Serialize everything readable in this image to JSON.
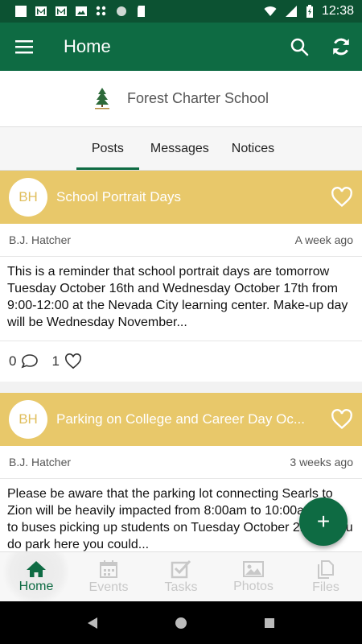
{
  "status_bar": {
    "time": "12:38"
  },
  "app_bar": {
    "title": "Home"
  },
  "school": {
    "name": "Forest Charter School"
  },
  "tabs": [
    {
      "label": "Posts",
      "active": true
    },
    {
      "label": "Messages",
      "active": false
    },
    {
      "label": "Notices",
      "active": false
    }
  ],
  "posts": [
    {
      "initials": "BH",
      "title": "School Portrait Days",
      "author": "B.J. Hatcher",
      "time": "A week ago",
      "body": "This is a reminder that school portrait days are tomorrow Tuesday October 16th and Wednesday October 17th from 9:00-12:00 at the Nevada City learning center. Make-up day will be Wednesday November...",
      "comments": "0",
      "likes": "1"
    },
    {
      "initials": "BH",
      "title": "Parking on College and Career Day Oc...",
      "author": "B.J. Hatcher",
      "time": "3 weeks ago",
      "body": "Please be aware that the parking lot connecting Searls to Zion will be heavily impacted from 8:00am to 10:00am due to buses picking up students on Tuesday October 2nd. If you do park here you could..."
    }
  ],
  "fab": {
    "label": "+"
  },
  "bottom_nav": [
    {
      "label": "Home",
      "icon": "home-icon",
      "active": true
    },
    {
      "label": "Events",
      "icon": "calendar-icon",
      "active": false
    },
    {
      "label": "Tasks",
      "icon": "tasks-icon",
      "active": false
    },
    {
      "label": "Photos",
      "icon": "photo-icon",
      "active": false
    },
    {
      "label": "Files",
      "icon": "files-icon",
      "active": false
    }
  ],
  "colors": {
    "primary": "#0e6b43",
    "status_bar": "#0c5232",
    "post_header": "#e8c86a"
  }
}
